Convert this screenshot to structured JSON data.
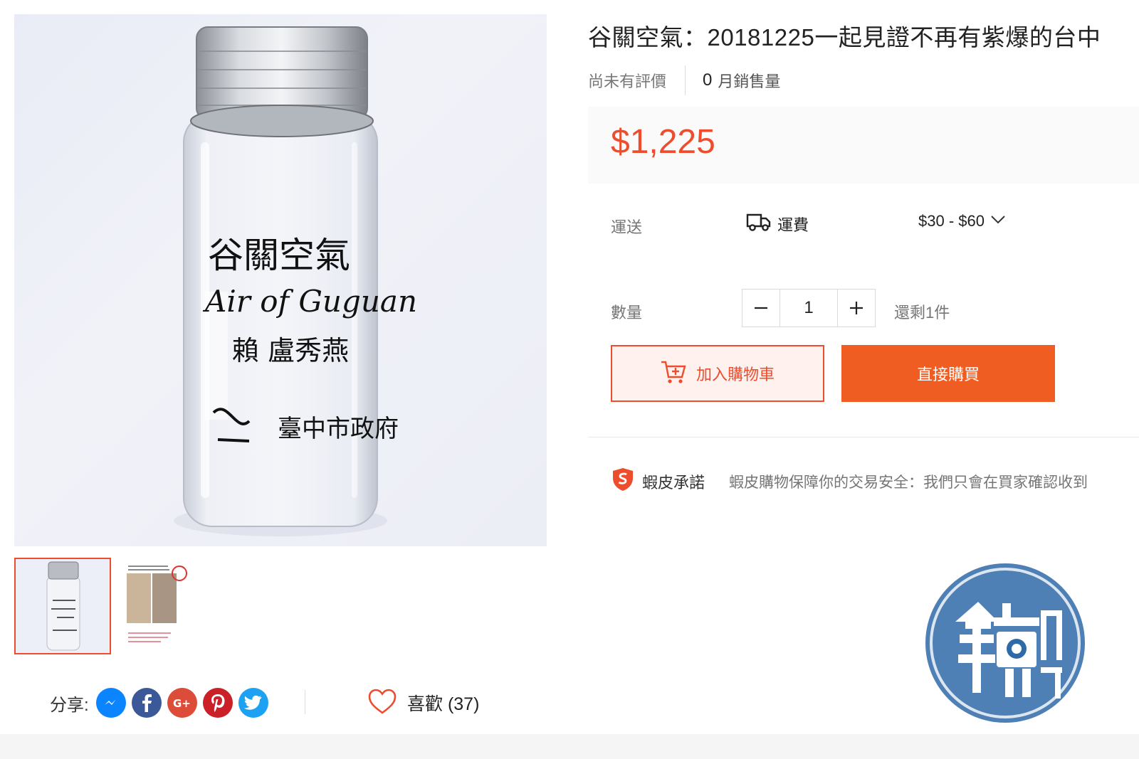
{
  "product": {
    "title": "谷關空氣：20181225一起見證不再有紫爆的台中",
    "rating_text": "尚未有評價",
    "sold_count": "0",
    "sold_label": "月銷售量",
    "price": "$1,225"
  },
  "image": {
    "handwriting": {
      "line1": "谷關空氣",
      "line2": "Air of Guguan",
      "line3": "賴 盧秀燕",
      "line4": "臺中市政府"
    }
  },
  "shipping": {
    "label": "運送",
    "fee_label": "運費",
    "range": "$30 - $60"
  },
  "quantity": {
    "label": "數量",
    "value": "1",
    "stock_text": "還剩1件"
  },
  "actions": {
    "add_to_cart": "加入購物車",
    "buy_now": "直接購買"
  },
  "guarantee": {
    "title": "蝦皮承諾",
    "text": "蝦皮購物保障你的交易安全：我們只會在買家確認收到"
  },
  "share": {
    "label": "分享:",
    "icons": [
      "messenger-icon",
      "facebook-icon",
      "google-plus-icon",
      "pinterest-icon",
      "twitter-icon"
    ]
  },
  "like": {
    "label": "喜歡 (37)"
  },
  "watermark": {
    "text": "鏡週刊"
  },
  "colors": {
    "accent": "#ee4d2d",
    "buy_button": "#f05d23",
    "price_bg": "#fafafa"
  }
}
